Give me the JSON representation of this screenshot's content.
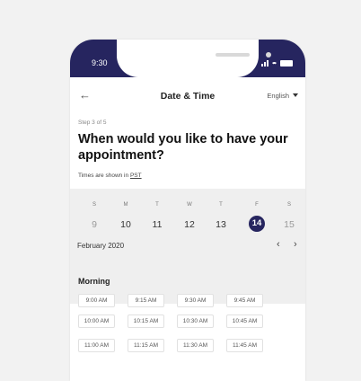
{
  "statusbar": {
    "time": "9:30"
  },
  "header": {
    "back_icon": "arrow-left",
    "title": "Date & Time",
    "language": "English"
  },
  "step_text": "Step 3 of 5",
  "question": "When would you like to have your appointment?",
  "timezone": {
    "label": "Times are shown in",
    "value": "PST"
  },
  "calendar": {
    "days": [
      {
        "dow": "S",
        "date": "9"
      },
      {
        "dow": "M",
        "date": "10"
      },
      {
        "dow": "T",
        "date": "11"
      },
      {
        "dow": "W",
        "date": "12"
      },
      {
        "dow": "T",
        "date": "13"
      },
      {
        "dow": "F",
        "date": "14"
      },
      {
        "dow": "S",
        "date": "15"
      }
    ],
    "selected_date": "14",
    "month_label": "February 2020",
    "prev_icon": "chevron-left",
    "next_icon": "chevron-right"
  },
  "morning": {
    "label": "Morning",
    "slots": [
      "9:00 AM",
      "9:15 AM",
      "9:30 AM",
      "9:45 AM",
      "10:00 AM",
      "10:15 AM",
      "10:30 AM",
      "10:45 AM",
      "11:00 AM",
      "11:15 AM",
      "11:30 AM",
      "11:45 AM"
    ]
  },
  "colors": {
    "accent": "#26255f",
    "calendar_bg": "#efefef",
    "page_bg": "#f2f2f2"
  }
}
